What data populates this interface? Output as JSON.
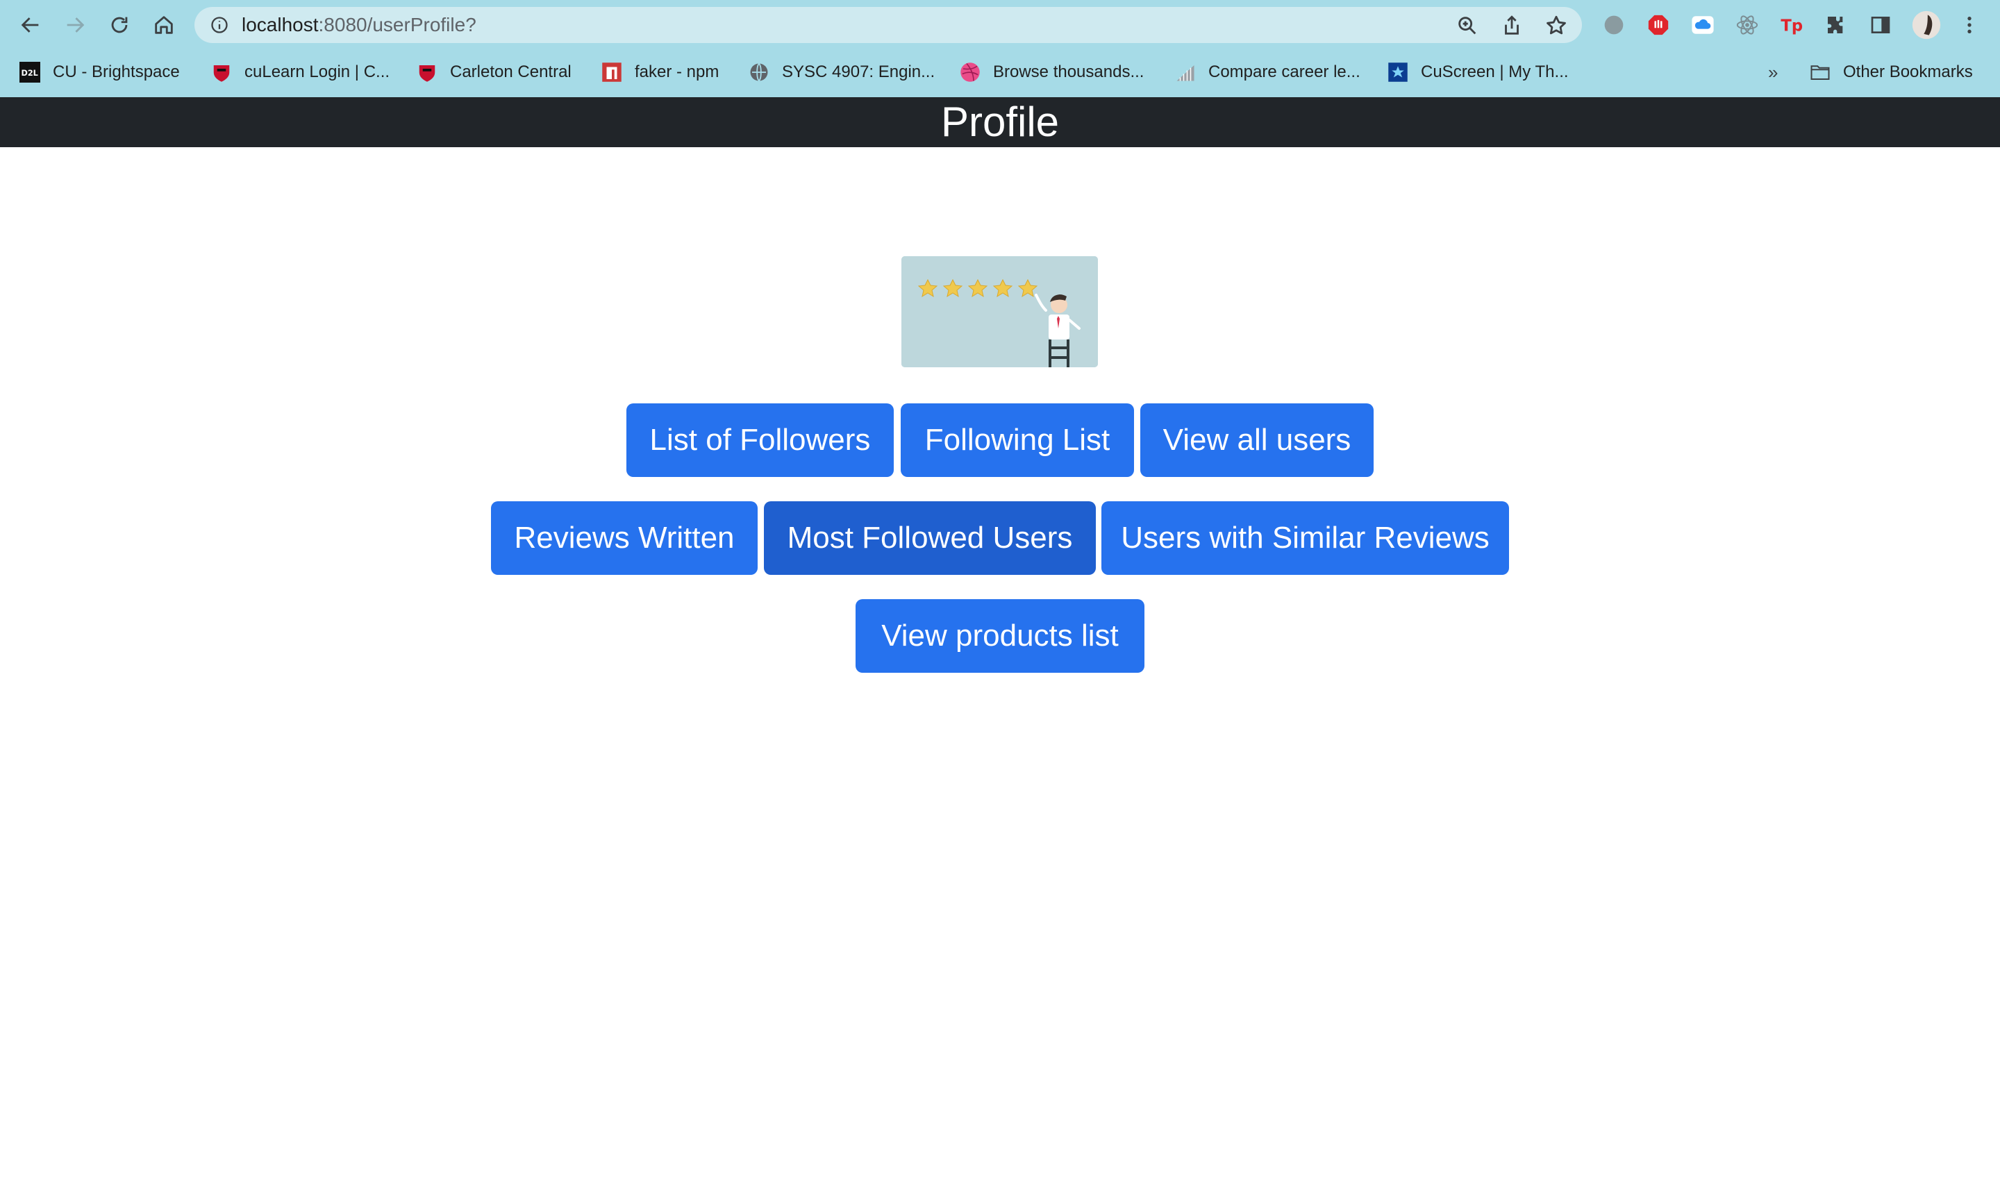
{
  "browser": {
    "url_host": "localhost",
    "url_path": ":8080/userProfile?",
    "bookmarks": [
      {
        "label": "CU - Brightspace",
        "icon": "d2l-icon"
      },
      {
        "label": "cuLearn Login | C...",
        "icon": "carleton-shield-icon"
      },
      {
        "label": "Carleton Central",
        "icon": "carleton-shield-icon"
      },
      {
        "label": "faker - npm",
        "icon": "npm-icon"
      },
      {
        "label": "SYSC 4907: Engin...",
        "icon": "globe-icon"
      },
      {
        "label": "Browse thousands...",
        "icon": "dribbble-icon"
      },
      {
        "label": "Compare career le...",
        "icon": "chart-icon"
      },
      {
        "label": "CuScreen | My Th...",
        "icon": "cuscreen-icon"
      }
    ],
    "more_bookmarks": "»",
    "other_bookmarks": "Other Bookmarks"
  },
  "page": {
    "title": "Profile",
    "hero_image": "rating-stars-illustration",
    "buttons": {
      "followers": "List of Followers",
      "following": "Following List",
      "all_users": "View all users",
      "reviews_written": "Reviews Written",
      "most_followed": "Most Followed Users",
      "similar_reviews": "Users with Similar Reviews",
      "products": "View products list"
    }
  },
  "colors": {
    "chrome_bg": "#a6dbe7",
    "navbar_bg": "#212529",
    "button_primary": "#2672ee",
    "button_active": "#1f5fcf"
  }
}
